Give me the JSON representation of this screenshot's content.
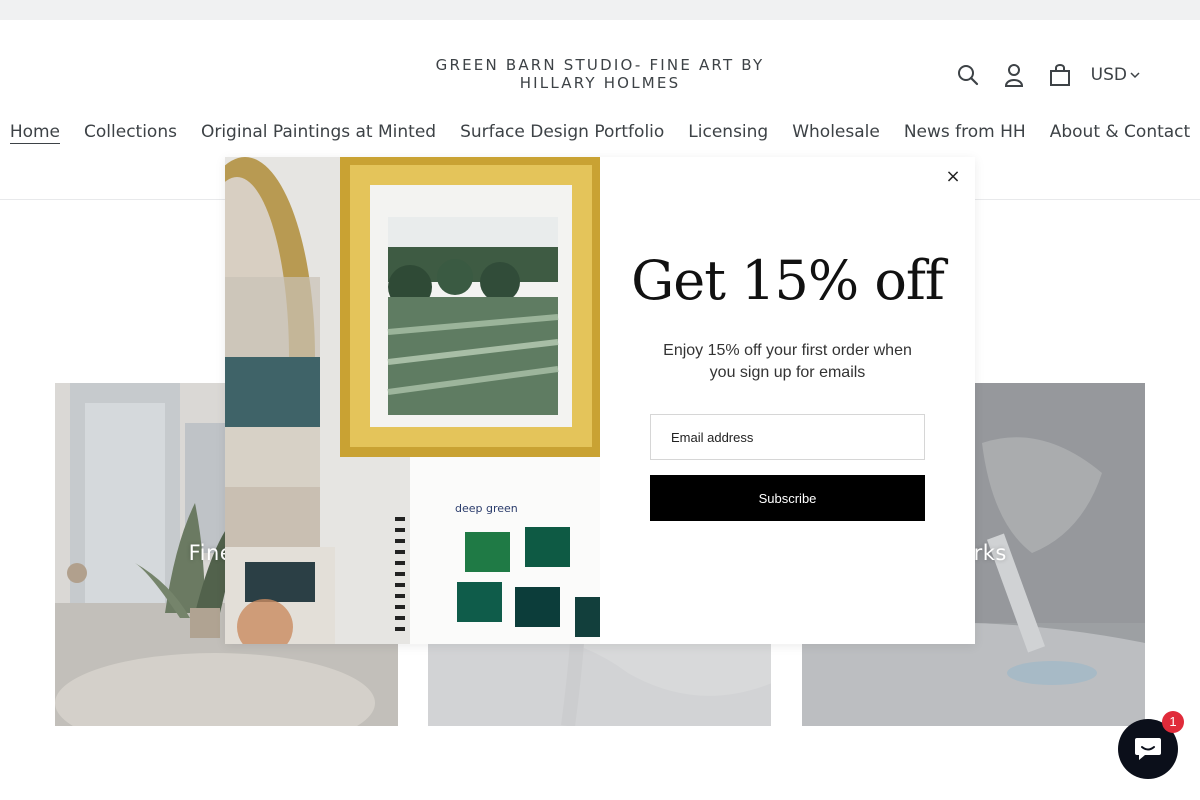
{
  "site": {
    "logo_text": "GREEN BARN STUDIO- FINE ART BY HILLARY HOLMES"
  },
  "header": {
    "search_icon": "search-icon",
    "account_icon": "user-icon",
    "cart_icon": "cart-icon",
    "currency": "USD"
  },
  "nav": {
    "items": [
      {
        "label": "Home",
        "active": true
      },
      {
        "label": "Collections",
        "active": false
      },
      {
        "label": "Original Paintings at Minted",
        "active": false
      },
      {
        "label": "Surface Design Portfolio",
        "active": false
      },
      {
        "label": "Licensing",
        "active": false
      },
      {
        "label": "Wholesale",
        "active": false
      },
      {
        "label": "News from HH",
        "active": false
      },
      {
        "label": "About & Contact",
        "active": false
      }
    ]
  },
  "collections": {
    "cards": [
      {
        "title_visible": "Fine Ar"
      },
      {
        "title_visible": ""
      },
      {
        "title_visible": "Works"
      }
    ]
  },
  "popup": {
    "headline": "Get 15% off",
    "subtext": "Enjoy 15% off your first order when you sign up for emails",
    "email_placeholder": "Email address",
    "subscribe_label": "Subscribe",
    "close_label": "×"
  },
  "chat": {
    "badge_count": "1",
    "icon": "chat-icon"
  },
  "colors": {
    "popup_button": "#000000",
    "badge": "#e02b3a",
    "chat_button": "#0b0f1a",
    "frame_gold": "#c9a233"
  }
}
